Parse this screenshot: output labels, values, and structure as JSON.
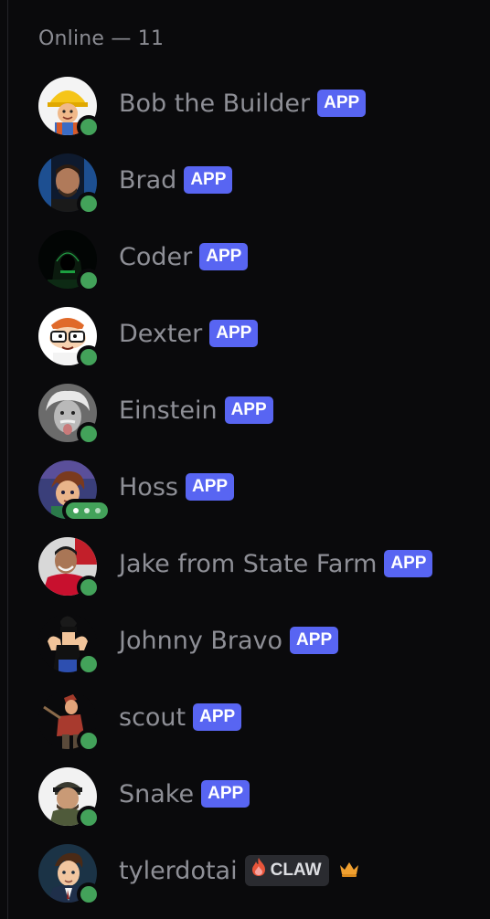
{
  "section": {
    "header": "Online — 11"
  },
  "tags": {
    "app": "APP",
    "claw": "CLAW"
  },
  "status_colors": {
    "online": "#43a25a"
  },
  "members": [
    {
      "name": "Bob the Builder",
      "tag": "APP",
      "status": "online",
      "avatar": "bob-the-builder-avatar"
    },
    {
      "name": "Brad",
      "tag": "APP",
      "status": "online",
      "avatar": "brad-avatar"
    },
    {
      "name": "Coder",
      "tag": "APP",
      "status": "online",
      "avatar": "coder-avatar"
    },
    {
      "name": "Dexter",
      "tag": "APP",
      "status": "online",
      "avatar": "dexter-avatar"
    },
    {
      "name": "Einstein",
      "tag": "APP",
      "status": "online",
      "avatar": "einstein-avatar"
    },
    {
      "name": "Hoss",
      "tag": "APP",
      "status": "typing",
      "avatar": "hoss-avatar"
    },
    {
      "name": "Jake from State Farm",
      "tag": "APP",
      "status": "online",
      "avatar": "jake-avatar"
    },
    {
      "name": "Johnny Bravo",
      "tag": "APP",
      "status": "online",
      "avatar": "johnny-bravo-avatar"
    },
    {
      "name": "scout",
      "tag": "APP",
      "status": "online",
      "avatar": "scout-avatar"
    },
    {
      "name": "Snake",
      "tag": "APP",
      "status": "online",
      "avatar": "snake-avatar"
    },
    {
      "name": "tylerdotai",
      "tag": "CLAW",
      "status": "online",
      "avatar": "tylerdotai-avatar",
      "owner_icon": "crown-icon"
    }
  ]
}
